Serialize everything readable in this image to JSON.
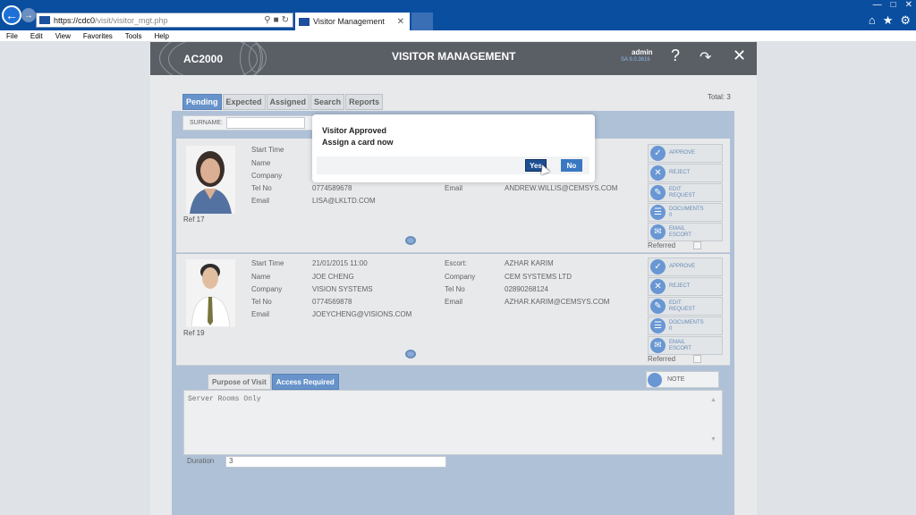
{
  "browser": {
    "url_host": "https://cdc0",
    "url_path": "/visit/visitor_mgt.php",
    "tab_title": "Visitor Management",
    "menu": [
      "File",
      "Edit",
      "View",
      "Favorites",
      "Tools",
      "Help"
    ]
  },
  "header": {
    "brand": "AC2000",
    "title": "VISITOR MANAGEMENT",
    "user": "admin",
    "version": "SA 9.0.3616"
  },
  "total_label": "Total: 3",
  "tabs": [
    "Pending",
    "Expected",
    "Assigned",
    "Search",
    "Reports"
  ],
  "surname_label": "SURNAME:",
  "visitors": [
    {
      "ref": "Ref 17",
      "labels": {
        "start": "Start Time",
        "name": "Name",
        "company": "Company",
        "tel": "Tel No",
        "email": "Email"
      },
      "tel": "0774589678",
      "email": "LISA@LKLTD.COM",
      "escort_email_label": "Email",
      "escort_email": "ANDREW.WILLIS@CEMSYS.COM"
    },
    {
      "ref": "Ref 19",
      "labels": {
        "start": "Start Time",
        "name": "Name",
        "company": "Company",
        "tel": "Tel No",
        "email": "Email"
      },
      "start": "21/01/2015 11:00",
      "name": "JOE CHENG",
      "company": "VISION SYSTEMS",
      "tel": "0774569878",
      "email": "JOEYCHENG@VISIONS.COM",
      "escort_labels": {
        "escort": "Escort:",
        "company": "Company",
        "tel": "Tel No",
        "email": "Email"
      },
      "escort": "AZHAR KARIM",
      "escort_company": "CEM SYSTEMS LTD",
      "escort_tel": "02890268124",
      "escort_email": "AZHAR.KARIM@CEMSYS.COM"
    }
  ],
  "actions": {
    "approve": "APPROVE",
    "reject": "REJECT",
    "edit_1": "EDIT",
    "edit_2": "REQUEST",
    "docs_1": "DOCUMENTS",
    "docs_2": "0",
    "email_1": "EMAIL",
    "email_2": "ESCORT",
    "referred": "Referred"
  },
  "detail_tabs": [
    "Purpose of Visit",
    "Access Required"
  ],
  "note_label": "NOTE",
  "access_text": "Server Rooms Only",
  "duration_label": "Duration",
  "duration_value": "3",
  "modal": {
    "line1": "Visitor Approved",
    "line2": "Assign a card now",
    "yes": "Yes",
    "no": "No"
  },
  "colors": {
    "chrome": "#0a4ea0",
    "header": "#5a5f66",
    "accent": "#5b8ac6",
    "panel": "#a9bcd4"
  },
  "icons": [
    "back-icon",
    "forward-icon",
    "search-icon",
    "lock-icon",
    "refresh-icon",
    "home-icon",
    "star-icon",
    "gear-icon",
    "help-icon",
    "logout-icon",
    "close-icon",
    "check-icon",
    "x-icon",
    "magnifier-icon"
  ]
}
